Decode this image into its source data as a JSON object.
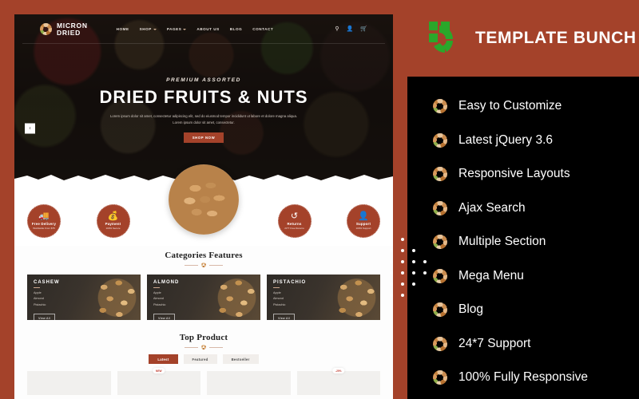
{
  "theme": {
    "accent": "#a4422a",
    "logo_green": "#2aa72a",
    "panel_bg": "#000000",
    "page_bg": "#ffffff"
  },
  "preview": {
    "site": {
      "brand": {
        "line1": "MICRON",
        "line2": "DRIED",
        "icon": "nut-ring-icon"
      },
      "nav": [
        {
          "label": "HOME",
          "has_dropdown": false
        },
        {
          "label": "SHOP",
          "has_dropdown": true
        },
        {
          "label": "PAGES",
          "has_dropdown": true
        },
        {
          "label": "ABOUT US",
          "has_dropdown": false
        },
        {
          "label": "BLOG",
          "has_dropdown": false
        },
        {
          "label": "CONTACT",
          "has_dropdown": false
        }
      ],
      "header_icons": [
        {
          "name": "search-icon",
          "glyph": "⌕"
        },
        {
          "name": "account-icon",
          "glyph": "●"
        },
        {
          "name": "cart-icon",
          "glyph": "⛾"
        }
      ],
      "hero": {
        "eyebrow": "PREMIUM ASSORTED",
        "title": "DRIED FRUITS & NUTS",
        "description": "Lorem ipsum dolor sit amet, consectetur adipiscing elit, sed do eiusmod tempor incididunt ut labore et dolore magna aliqua. Lorem ipsum dolor sit amet, consectetur.",
        "cta_label": "SHOP NOW",
        "prev_arrow": "‹",
        "next_arrow": "›"
      },
      "features": [
        {
          "icon": "truck-icon",
          "glyph": "\u0001F69a",
          "title": "Free Delivery",
          "sub": "Worldwide From $75"
        },
        {
          "icon": "money-bag-icon",
          "glyph": "\u0001F4B0",
          "title": "Payment",
          "sub": "100% Secure"
        },
        {
          "icon": "returns-icon",
          "glyph": "↺",
          "title": "Returns",
          "sub": "24*7 Free Returns"
        },
        {
          "icon": "support-icon",
          "glyph": "\u0001F464",
          "title": "Support",
          "sub": "100% Support"
        }
      ],
      "categories_section": {
        "title": "Categories Features",
        "cards": [
          {
            "name": "CASHEW",
            "items": [
              "Apple",
              "Almond",
              "Pistachio"
            ],
            "button": "View All"
          },
          {
            "name": "ALMOND",
            "items": [
              "Apple",
              "Almond",
              "Pistachio"
            ],
            "button": "View All"
          },
          {
            "name": "PISTACHIO",
            "items": [
              "Apple",
              "Almond",
              "Pistachio"
            ],
            "button": "View All"
          }
        ]
      },
      "top_product_section": {
        "title": "Top Product",
        "tabs": [
          {
            "label": "Latest",
            "active": true
          },
          {
            "label": "Featured",
            "active": false
          },
          {
            "label": "Bestseller",
            "active": false
          }
        ],
        "products": [
          {
            "badge": ""
          },
          {
            "badge": "NEW"
          },
          {
            "badge": ""
          },
          {
            "badge": "-20%"
          }
        ]
      }
    }
  },
  "info_panel": {
    "title": "TEMPLATE BUNCH",
    "logo_name": "template-bunch-logo",
    "features": [
      {
        "label": "Easy to Customize"
      },
      {
        "label": "Latest jQuery 3.6"
      },
      {
        "label": "Responsive Layouts"
      },
      {
        "label": "Ajax Search"
      },
      {
        "label": "Multiple Section"
      },
      {
        "label": "Mega Menu"
      },
      {
        "label": "Blog"
      },
      {
        "label": "24*7 Support"
      },
      {
        "label": "100% Fully Responsive"
      }
    ]
  }
}
